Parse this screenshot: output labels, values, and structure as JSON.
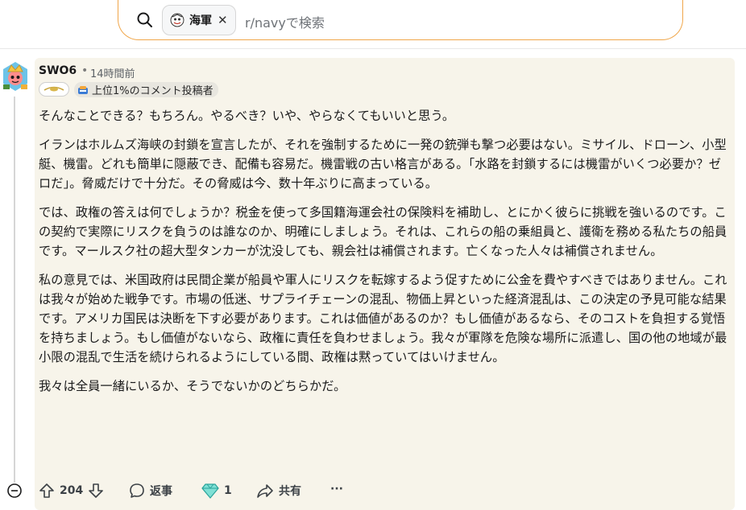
{
  "search": {
    "subreddit_chip": "海軍",
    "placeholder": "r/navyで検索"
  },
  "comment": {
    "username": "SWO6",
    "separator": "•",
    "timestamp": "14時間前",
    "badge": "上位1%のコメント投稿者",
    "paragraphs": [
      "そんなことできる？もちろん。やるべき？いや、やらなくてもいいと思う。",
      "イランはホルムズ海峡の封鎖を宣言したが、それを強制するために一発の銃弾も撃つ必要はない。ミサイル、ドローン、小型艇、機雷。どれも簡単に隠蔽でき、配備も容易だ。機雷戦の古い格言がある。「水路を封鎖するには機雷がいくつ必要か？ゼロだ」。脅威だけで十分だ。その脅威は今、数十年ぶりに高まっている。",
      "では、政権の答えは何でしょうか？税金を使って多国籍海運会社の保険料を補助し、とにかく彼らに挑戦を強いるのです。この契約で実際にリスクを負うのは誰なのか、明確にしましょう。それは、これらの船の乗組員と、護衛を務める私たちの船員です。マールスク社の超大型タンカーが沈没しても、親会社は補償されます。亡くなった人々は補償されません。",
      "私の意見では、米国政府は民間企業が船員や軍人にリスクを転嫁するよう促すために公金を費やすべきではありません。これは我々が始めた戦争です。市場の低迷、サプライチェーンの混乱、物価上昇といった経済混乱は、この決定の予見可能な結果です。アメリカ国民は決断を下す必要があります。これは価値があるのか？もし価値があるなら、そのコストを負担する覚悟を持ちましょう。もし価値がないなら、政権に責任を負わせましょう。我々が軍隊を危険な場所に派遣し、国の他の地域が最小限の混乱で生活を続けられるようにしている間、政権は黙っていてはいけません。",
      "我々は全員一緒にいるか、そうでないかのどちらかだ。"
    ],
    "votes": "204",
    "reply_label": "返事",
    "award_count": "1",
    "share_label": "共有",
    "more_label": "···"
  },
  "colors": {
    "search_border": "#f0a64a",
    "card_bg": "#f7f4ea"
  }
}
